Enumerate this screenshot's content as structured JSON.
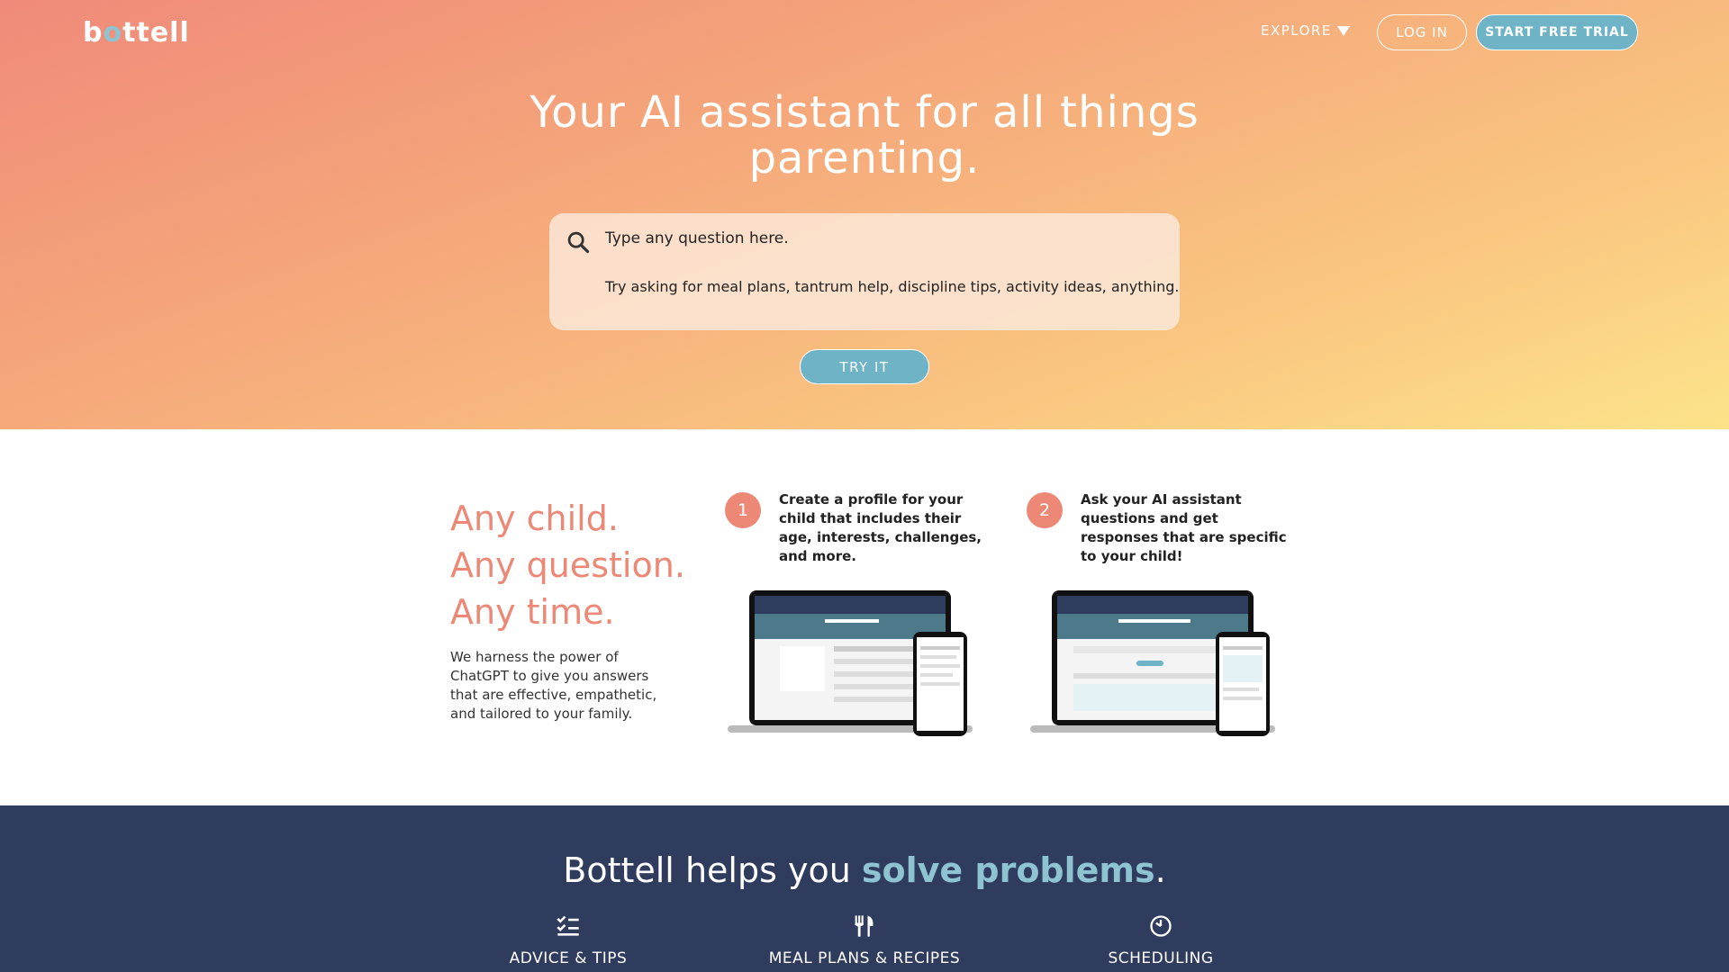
{
  "header": {
    "logo_b": "b",
    "logo_o": "o",
    "logo_rest": "ttell",
    "explore_label": "EXPLORE",
    "login_label": "LOG IN",
    "trial_label": "START FREE TRIAL"
  },
  "hero": {
    "title": "Your AI assistant for all things parenting.",
    "search_question": "Type any question here.",
    "search_hint": "Try asking for meal plans, tantrum help, discipline tips, activity ideas, anything.",
    "try_label": "TRY IT"
  },
  "intro": {
    "line1": "Any child.",
    "line2": "Any question.",
    "line3": "Any time.",
    "description": "We harness the power of ChatGPT to give you answers that are effective, empathetic, and tailored to your family."
  },
  "steps": [
    {
      "num": "1",
      "text": "Create a profile for your child that includes their age, interests, challenges, and more."
    },
    {
      "num": "2",
      "text": "Ask your AI assistant questions and get responses that are specific to your child!"
    }
  ],
  "band": {
    "title_prefix": "Bottell helps you ",
    "title_highlight": "solve problems",
    "title_suffix": ".",
    "features": [
      {
        "label": "ADVICE & TIPS",
        "icon": "checklist-icon"
      },
      {
        "label": "MEAL PLANS & RECIPES",
        "icon": "utensils-icon"
      },
      {
        "label": "SCHEDULING",
        "icon": "clock-icon"
      }
    ]
  },
  "colors": {
    "accent_coral": "#ec8875",
    "accent_teal": "#6fb4c6",
    "navy": "#2f3c5e"
  }
}
